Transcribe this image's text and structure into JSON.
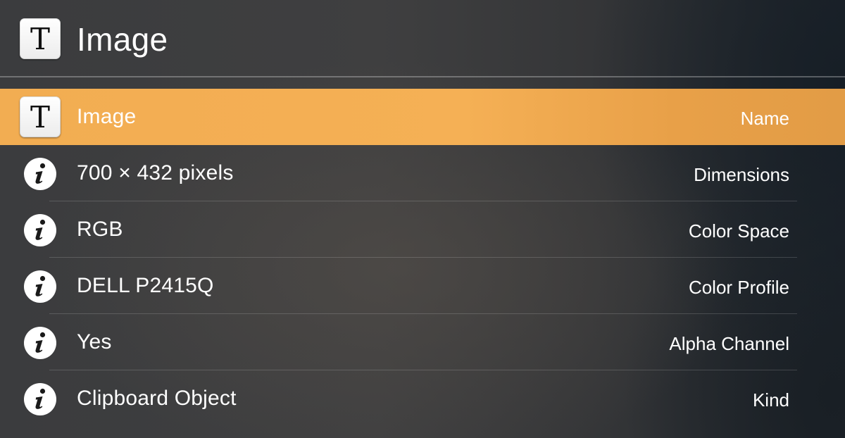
{
  "header": {
    "icon_glyph": "T",
    "icon_name": "text-document-icon",
    "title": "Image"
  },
  "rows": [
    {
      "value": "Image",
      "label": "Name",
      "icon": "text-document-icon",
      "icon_glyph": "T",
      "selected": true
    },
    {
      "value": "700 × 432 pixels",
      "label": "Dimensions",
      "icon": "info-icon",
      "selected": false
    },
    {
      "value": "RGB",
      "label": "Color Space",
      "icon": "info-icon",
      "selected": false
    },
    {
      "value": "DELL P2415Q",
      "label": "Color Profile",
      "icon": "info-icon",
      "selected": false
    },
    {
      "value": "Yes",
      "label": "Alpha Channel",
      "icon": "info-icon",
      "selected": false
    },
    {
      "value": "Clipboard Object",
      "label": "Kind",
      "icon": "info-icon",
      "selected": false
    }
  ],
  "colors": {
    "selection": "#f5b055",
    "background": "#3b3c3e",
    "text": "#ffffff"
  }
}
